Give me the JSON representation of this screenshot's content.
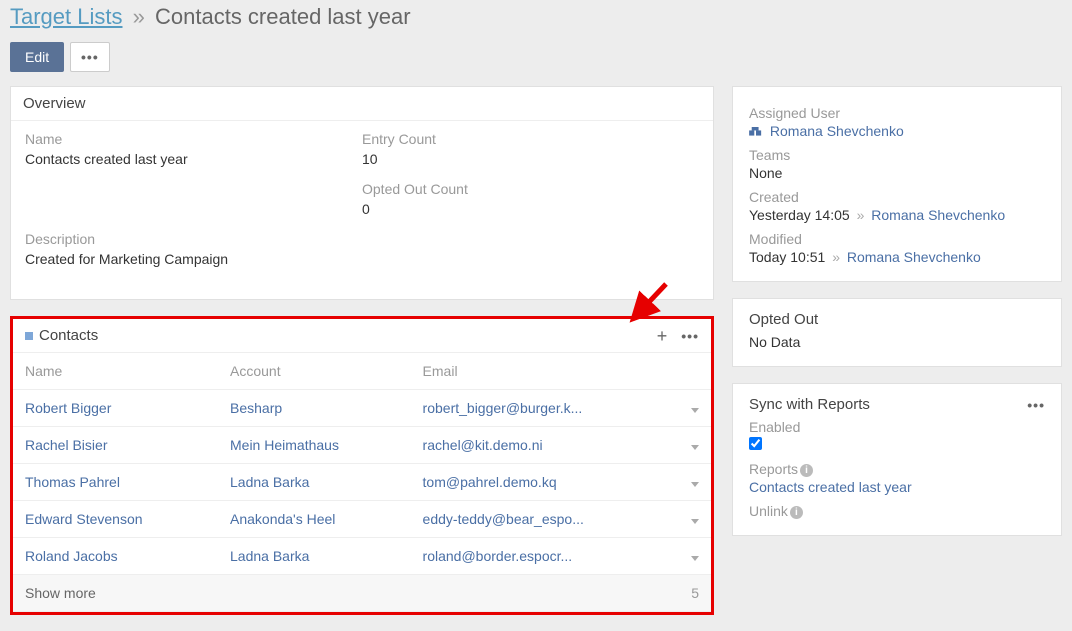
{
  "breadcrumb": {
    "root": "Target Lists",
    "sep": "»",
    "current": "Contacts created last year"
  },
  "toolbar": {
    "edit": "Edit"
  },
  "overview": {
    "title": "Overview",
    "name_label": "Name",
    "name_value": "Contacts created last year",
    "entry_count_label": "Entry Count",
    "entry_count_value": "10",
    "opted_out_label": "Opted Out Count",
    "opted_out_value": "0",
    "description_label": "Description",
    "description_value": "Created for Marketing Campaign"
  },
  "contacts": {
    "title": "Contacts",
    "columns": {
      "name": "Name",
      "account": "Account",
      "email": "Email"
    },
    "rows": [
      {
        "name": "Robert Bigger",
        "account": "Besharp",
        "email": "robert_bigger@burger.k..."
      },
      {
        "name": "Rachel Bisier",
        "account": "Mein Heimathaus",
        "email": "rachel@kit.demo.ni"
      },
      {
        "name": "Thomas Pahrel",
        "account": "Ladna Barka",
        "email": "tom@pahrel.demo.kq"
      },
      {
        "name": "Edward Stevenson",
        "account": "Anakonda's Heel",
        "email": "eddy-teddy@bear_espo..."
      },
      {
        "name": "Roland Jacobs",
        "account": "Ladna Barka",
        "email": "roland@border.espocr..."
      }
    ],
    "show_more": "Show more",
    "remaining": "5"
  },
  "side": {
    "assigned_user_label": "Assigned User",
    "assigned_user_value": "Romana Shevchenko",
    "teams_label": "Teams",
    "teams_value": "None",
    "created_label": "Created",
    "created_value": "Yesterday 14:05",
    "created_by": "Romana Shevchenko",
    "modified_label": "Modified",
    "modified_value": "Today 10:51",
    "modified_by": "Romana Shevchenko",
    "sep": "»"
  },
  "opted_out": {
    "title": "Opted Out",
    "value": "No Data"
  },
  "sync": {
    "title": "Sync with Reports",
    "enabled_label": "Enabled",
    "reports_label": "Reports",
    "reports_value": "Contacts created last year",
    "unlink_label": "Unlink"
  }
}
